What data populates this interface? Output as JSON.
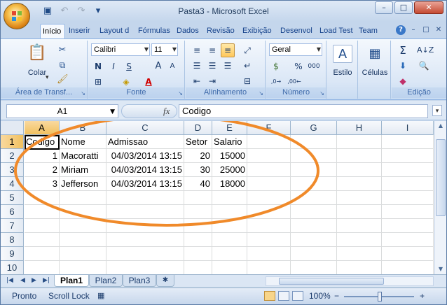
{
  "window": {
    "title": "Pasta3 - Microsoft Excel",
    "controls": {
      "minimize": "–",
      "restore": "□",
      "close": "✕"
    }
  },
  "quick_access": {
    "save": "save-icon",
    "undo": "undo-icon",
    "redo": "redo-icon",
    "customize": "customize-icon"
  },
  "ribbon_tabs": [
    "Início",
    "Inserir",
    "Layout d",
    "Fórmulas",
    "Dados",
    "Revisão",
    "Exibição",
    "Desenvol",
    "Load Test",
    "Team"
  ],
  "active_tab": "Início",
  "ribbon": {
    "clipboard": {
      "label": "Área de Transf...",
      "paste": "Colar"
    },
    "font": {
      "label": "Fonte",
      "name": "Calibri",
      "size": "11",
      "bold": "N",
      "italic": "I",
      "underline": "S",
      "grow": "A",
      "shrink": "A",
      "color": "A"
    },
    "alignment": {
      "label": "Alinhamento"
    },
    "number": {
      "label": "Número",
      "format": "Geral",
      "percent": "%",
      "thousands": "000"
    },
    "styles": {
      "label": "Estilo"
    },
    "cells": {
      "label": "Células"
    },
    "editing": {
      "label": "Edição",
      "sum": "Σ"
    }
  },
  "formula_bar": {
    "name_box": "A1",
    "fx": "fx",
    "formula": "Codigo"
  },
  "columns": [
    "A",
    "B",
    "C",
    "D",
    "E",
    "F",
    "G",
    "H",
    "I"
  ],
  "rows": [
    "1",
    "2",
    "3",
    "4",
    "5",
    "6",
    "7",
    "8",
    "9",
    "10"
  ],
  "cells": {
    "header": [
      "Codigo",
      "Nome",
      "Admissao",
      "Setor",
      "Salario"
    ],
    "data": [
      [
        "1",
        "Macoratti",
        "04/03/2014 13:15",
        "20",
        "15000"
      ],
      [
        "2",
        "Miriam",
        "04/03/2014 13:15",
        "30",
        "25000"
      ],
      [
        "3",
        "Jefferson",
        "04/03/2014 13:15",
        "40",
        "18000"
      ]
    ]
  },
  "sheets": [
    "Plan1",
    "Plan2",
    "Plan3"
  ],
  "active_sheet": "Plan1",
  "status": {
    "mode": "Pronto",
    "scroll_lock": "Scroll Lock",
    "zoom": "100%",
    "minus": "−",
    "plus": "+"
  },
  "annotation_color": "#f08a2a"
}
